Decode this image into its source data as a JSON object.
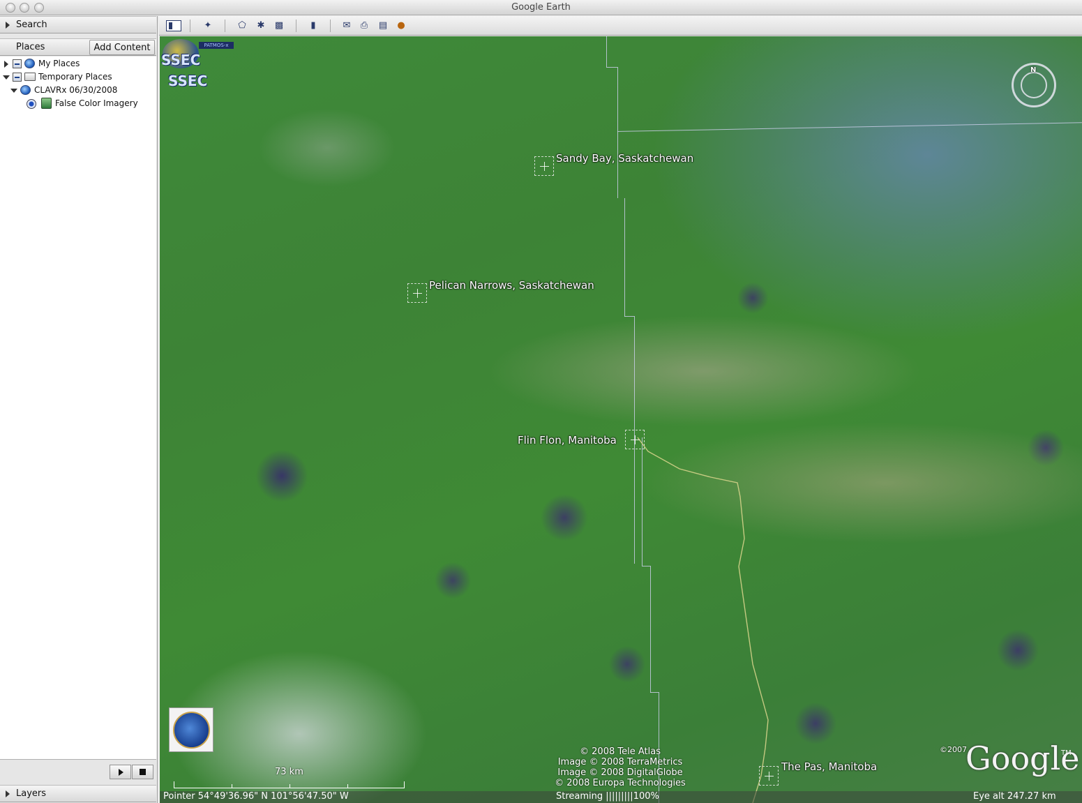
{
  "window": {
    "title": "Google Earth"
  },
  "sidebar": {
    "search_label": "Search",
    "places_label": "Places",
    "add_content_label": "Add Content",
    "layers_label": "Layers",
    "tree": {
      "my_places": "My Places",
      "temporary_places": "Temporary Places",
      "clavrx": "CLAVRx 06/30/2008",
      "false_color": "False Color Imagery"
    }
  },
  "toolbar": {
    "icons": [
      "sidebar-toggle-icon",
      "placemark-icon",
      "polygon-icon",
      "path-icon",
      "image-overlay-icon",
      "ruler-icon",
      "email-icon",
      "print-icon",
      "google-maps-icon",
      "sky-icon"
    ]
  },
  "map": {
    "places": {
      "sandy_bay": "Sandy Bay, Saskatchewan",
      "pelican_narrows": "Pelican Narrows, Saskatchewan",
      "flin_flon": "Flin Flon, Manitoba",
      "the_pas": "The Pas, Manitoba"
    },
    "logos": {
      "ssec_top": "SSEC",
      "ssec_bottom": "SSEC",
      "patmos": "PATMOS-x"
    },
    "compass_n": "N",
    "scale_label": "73 km",
    "credits": {
      "line1": "© 2008 Tele Atlas",
      "line2": "Image © 2008 TerraMetrics",
      "line3": "Image © 2008 DigitalGlobe",
      "line4": "© 2008 Europa Technologies"
    },
    "google_year": "©2007",
    "google_logo": "Google",
    "google_tm": "TM"
  },
  "status": {
    "pointer": "Pointer  54°49'36.96\" N  101°56'47.50\" W",
    "streaming": "Streaming  |||||||||100%",
    "eye_alt": "Eye alt    247.27 km"
  },
  "colors": {
    "vegetation": "#3f8a3a",
    "cloud_haze": "#7887e6",
    "smoke_plume": "#b4aa96",
    "lake": "#37286e"
  }
}
